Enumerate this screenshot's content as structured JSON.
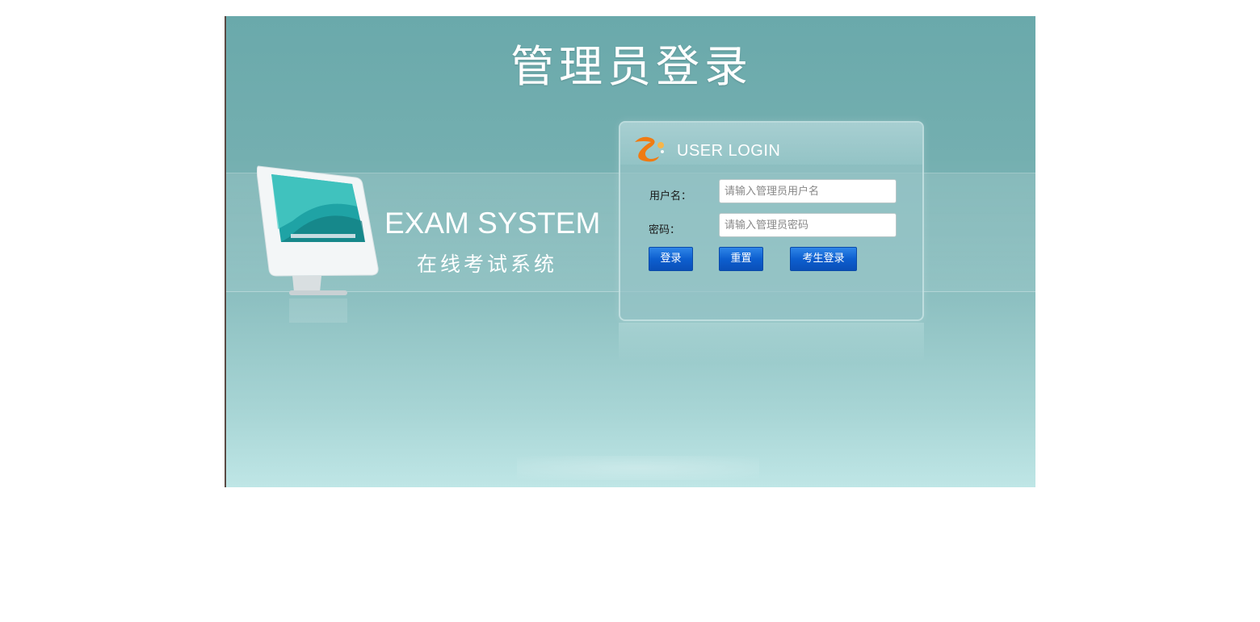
{
  "page": {
    "title": "管理员登录"
  },
  "brand": {
    "english": "EXAM SYSTEM",
    "chinese": "在线考试系统"
  },
  "login": {
    "header": "USER LOGIN",
    "username_label": "用户名：",
    "username_placeholder": "请输入管理员用户名",
    "username_value": "",
    "password_label": "密码：",
    "password_placeholder": "请输入管理员密码",
    "password_value": "",
    "login_button": "登录",
    "reset_button": "重置",
    "student_login_button": "考生登录"
  },
  "colors": {
    "background": "#6aa9ab",
    "button": "#0d5fcf",
    "logo_orange": "#f07b12"
  },
  "icons": {
    "panel_logo": "orange-swirl-logo",
    "illustration": "monitor-illustration"
  }
}
